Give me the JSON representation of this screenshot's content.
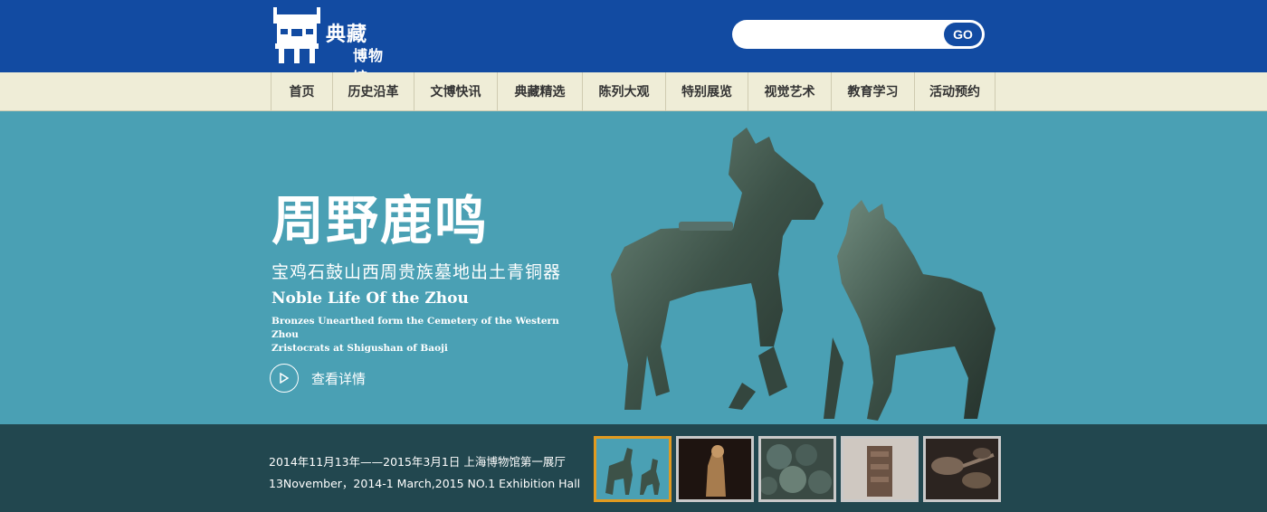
{
  "header": {
    "logo": {
      "line1": "典藏",
      "line2": "博物馆",
      "icon": "ding-vessel-icon"
    },
    "search": {
      "placeholder": "",
      "value": "",
      "button_label": "GO"
    }
  },
  "nav": {
    "items": [
      {
        "label": "首页"
      },
      {
        "label": "历史沿革"
      },
      {
        "label": "文博快讯"
      },
      {
        "label": "典藏精选"
      },
      {
        "label": "陈列大观"
      },
      {
        "label": "特别展览"
      },
      {
        "label": "视觉艺术"
      },
      {
        "label": "教育学习"
      },
      {
        "label": "活动预约"
      }
    ]
  },
  "banner": {
    "title_zh": "周野鹿鸣",
    "subtitle_zh": "宝鸡石鼓山西周贵族墓地出土青铜器",
    "title_en": "Noble Life Of the Zhou",
    "desc_en_line1": "Bronzes Unearthed form the Cemetery of the Western Zhou",
    "desc_en_line2": "Zristocrats at Shigushan of Baoji",
    "more_label": "查看详情",
    "more_icon": "play-icon"
  },
  "strip": {
    "date_zh": "2014年11月13年——2015年3月1日  上海博物馆第一展厅",
    "date_en": "13November，2014-1 March,2015  NO.1 Exhibition Hall",
    "thumbnails": [
      {
        "name": "bronze-deer-pair",
        "active": true
      },
      {
        "name": "bronze-figure",
        "active": false
      },
      {
        "name": "bronze-coins",
        "active": false
      },
      {
        "name": "bronze-block",
        "active": false
      },
      {
        "name": "bronze-spoons",
        "active": false
      }
    ]
  },
  "colors": {
    "header_bg": "#124ba2",
    "nav_bg": "#efedd7",
    "banner_bg": "#4aa0b4",
    "strip_bg": "#22474f",
    "thumb_active_border": "#e19a1f"
  }
}
